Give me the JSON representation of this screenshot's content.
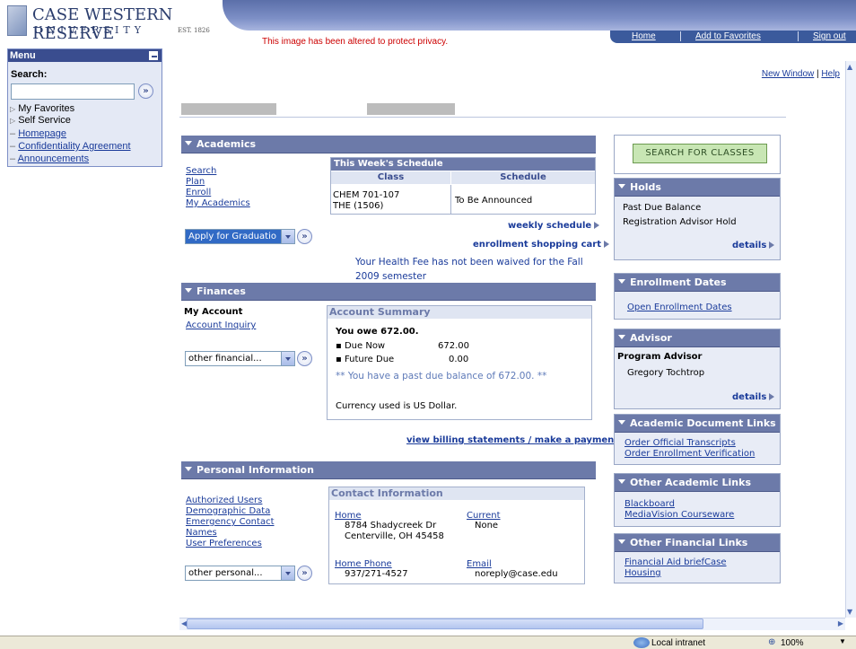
{
  "header": {
    "logo_line1": "CASE WESTERN RESERVE",
    "logo_line2": "UNIVERSITY",
    "logo_est": "EST. 1826",
    "privacy_notice": "This image has been altered to protect privacy.",
    "nav": {
      "home": "Home",
      "add_favorites": "Add to Favorites",
      "sign_out": "Sign out"
    }
  },
  "menu": {
    "title": "Menu",
    "search_label": "Search:",
    "search_value": "",
    "items": [
      {
        "label": "My Favorites",
        "type": "folder"
      },
      {
        "label": "Self Service",
        "type": "folder"
      },
      {
        "label": "Homepage",
        "type": "link"
      },
      {
        "label": "Confidentiality Agreement",
        "type": "link"
      },
      {
        "label": "Announcements",
        "type": "link"
      }
    ]
  },
  "top_links": {
    "new_window": "New Window",
    "help": "Help"
  },
  "academics": {
    "title": "Academics",
    "links": [
      "Search",
      "Plan",
      "Enroll",
      "My Academics"
    ],
    "dropdown": "Apply for Graduatio",
    "schedule": {
      "title": "This Week's Schedule",
      "col1": "Class",
      "col2": "Schedule",
      "class_line1": "CHEM 701-107",
      "class_line2": "THE (1506)",
      "schedule": "To Be Announced"
    },
    "weekly_schedule": "weekly schedule",
    "cart": "enrollment shopping cart",
    "health_notice_1": "Your Health Fee has not been waived for the Fall",
    "health_notice_2": "2009 semester"
  },
  "finances": {
    "title": "Finances",
    "my_account": "My Account",
    "account_inquiry": "Account Inquiry",
    "dropdown": "other financial...",
    "summary": {
      "title": "Account Summary",
      "you_owe": "You owe 672.00.",
      "due_now_label": "Due Now",
      "due_now": "672.00",
      "future_due_label": "Future Due",
      "future_due": "0.00",
      "past_due": "** You have a past due balance of 672.00. **",
      "currency": "Currency used is US Dollar."
    },
    "billing_link": "view billing statements / make a payment"
  },
  "personal": {
    "title": "Personal Information",
    "links": [
      "Authorized Users",
      "Demographic Data",
      "Emergency Contact",
      "Names",
      "User Preferences"
    ],
    "dropdown": "other personal...",
    "contact": {
      "title": "Contact Information",
      "home_label": "Home",
      "home_line1": "8784 Shadycreek Dr",
      "home_line2": "Centerville, OH 45458",
      "current_label": "Current",
      "current_value": "None",
      "phone_label": "Home Phone",
      "phone_value": "937/271-4527",
      "email_label": "Email",
      "email_value": "noreply@case.edu"
    }
  },
  "right": {
    "search_classes": "SEARCH FOR CLASSES",
    "holds": {
      "title": "Holds",
      "items": [
        "Past Due Balance",
        "Registration Advisor Hold"
      ],
      "details": "details"
    },
    "enrollment_dates": {
      "title": "Enrollment Dates",
      "link": "Open Enrollment Dates"
    },
    "advisor": {
      "title": "Advisor",
      "label": "Program Advisor",
      "name": "Gregory Tochtrop",
      "details": "details"
    },
    "doc_links": {
      "title": "Academic Document Links",
      "links": [
        "Order Official Transcripts",
        "Order Enrollment Verification"
      ]
    },
    "other_academic": {
      "title": "Other Academic Links",
      "links": [
        "Blackboard",
        "MediaVision Courseware"
      ]
    },
    "other_financial": {
      "title": "Other Financial Links",
      "links": [
        "Financial Aid briefCase",
        "Housing"
      ]
    }
  },
  "statusbar": {
    "zone": "Local intranet",
    "zoom": "100%"
  },
  "colors": {
    "panel_header": "#6c7aa9",
    "link": "#1a3b9a",
    "privacy": "#cc0000",
    "button_green": "#c8e6b4"
  }
}
